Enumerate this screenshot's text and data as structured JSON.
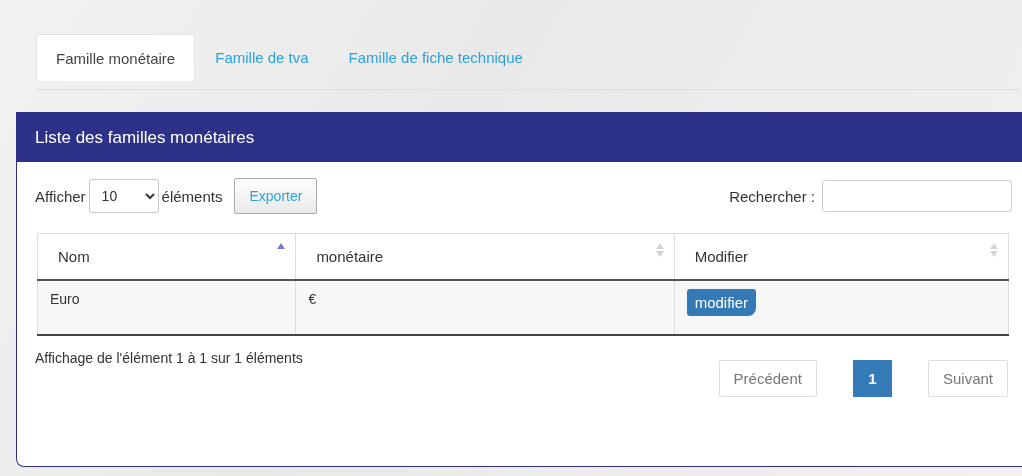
{
  "tabs": [
    {
      "label": "Famille monétaire",
      "selected": true
    },
    {
      "label": "Famille de tva",
      "selected": false
    },
    {
      "label": "Famille de fiche technique",
      "selected": false
    }
  ],
  "panel": {
    "title": "Liste des familles monétaires",
    "length_control": {
      "prefix": "Afficher",
      "value": "10",
      "suffix": "éléments"
    },
    "export_button": "Exporter",
    "search": {
      "label": "Rechercher :"
    },
    "table": {
      "columns": [
        {
          "label": "Nom",
          "sorted": true
        },
        {
          "label": "monétaire",
          "sorted": false
        },
        {
          "label": "Modifier",
          "sorted": false
        }
      ],
      "rows": [
        {
          "name": "Euro",
          "currency": "€",
          "action": "modifier"
        }
      ]
    },
    "info": "Affichage de l'élément 1 à 1 sur 1 éléments",
    "pagination": {
      "previous": "Précédent",
      "pages": [
        {
          "label": "1",
          "selected": true
        }
      ],
      "next": "Suivant"
    }
  }
}
